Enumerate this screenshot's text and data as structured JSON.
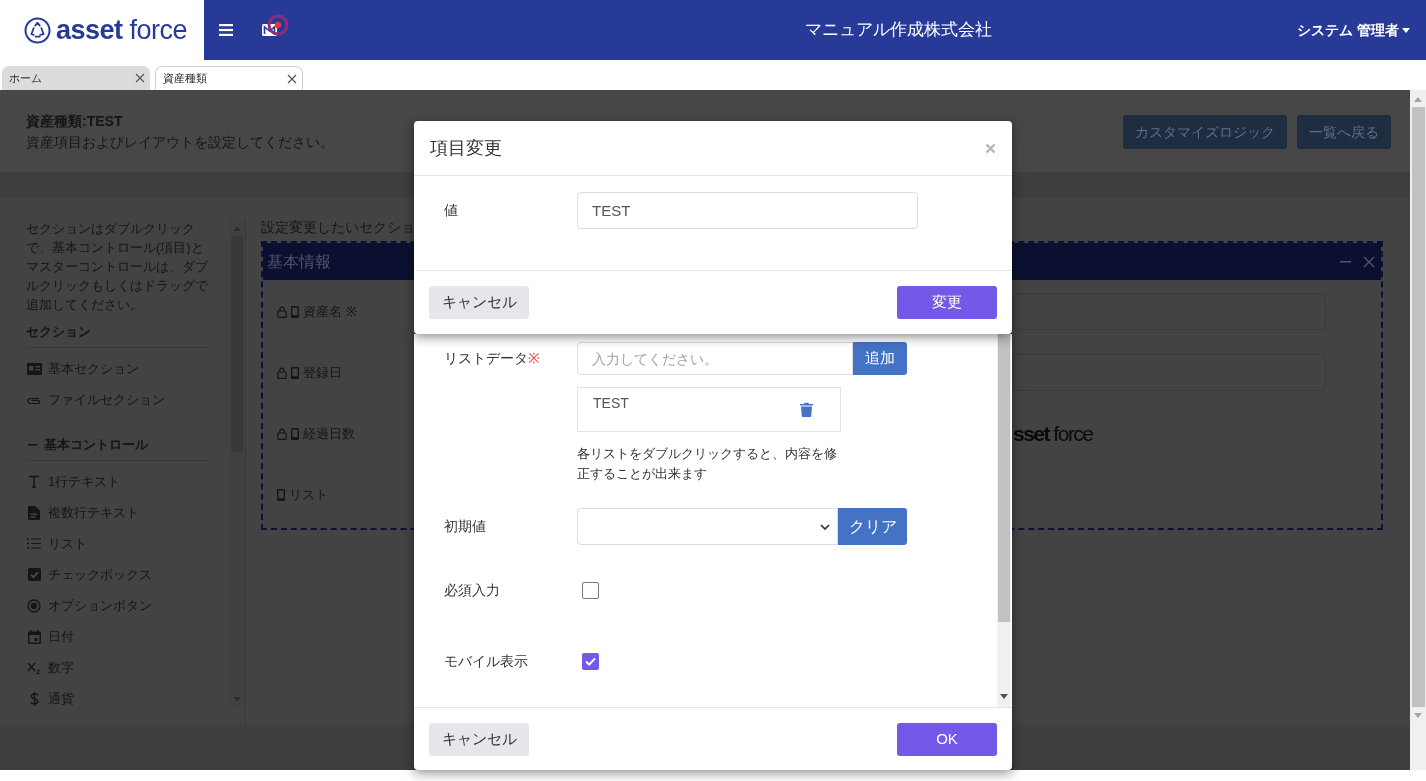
{
  "header": {
    "logo": "**asset** force",
    "mail_unread": true,
    "company": "マニュアル作成株式会社",
    "user": "システム 管理者"
  },
  "tabs": [
    {
      "label": "ホーム",
      "selected": false
    },
    {
      "label": "資産種類",
      "selected": true
    }
  ],
  "page": {
    "title": "資産種類:TEST",
    "subtitle": "資産項目およびレイアウトを設定してください。",
    "buttons": [
      "カスタマイズロジック",
      "一覧へ戻る"
    ]
  },
  "palette": {
    "help": "セクションはダブルクリックで、基本コントロール(項目)とマスターコントロールは、ダブルクリックもしくはドラッグで追加してください。",
    "groups": [
      {
        "title": "セクション",
        "collapsible": false,
        "items": [
          {
            "kind": "section",
            "label": "基本セクション"
          },
          {
            "kind": "file",
            "label": "ファイルセクション"
          }
        ]
      },
      {
        "title": "基本コントロール",
        "collapsible": true,
        "expanded": true,
        "items": [
          {
            "kind": "text",
            "label": "1行テキスト"
          },
          {
            "kind": "multiline",
            "label": "複数行テキスト"
          },
          {
            "kind": "list",
            "label": "リスト"
          },
          {
            "kind": "checkbox",
            "label": "チェックボックス"
          },
          {
            "kind": "radio",
            "label": "オプションボタン"
          },
          {
            "kind": "date",
            "label": "日付"
          },
          {
            "kind": "number",
            "label": "数字"
          },
          {
            "kind": "currency",
            "label": "通貨"
          }
        ]
      }
    ]
  },
  "canvas": {
    "instruction": "設定変更したいセクショ",
    "section": {
      "title": "基本情報",
      "fields": [
        {
          "kind": "input",
          "label": "資産名",
          "mark": "※",
          "locked": true,
          "mobile": true
        },
        {
          "kind": "input",
          "label": "登録日",
          "locked": true,
          "mobile": true
        },
        {
          "kind": "image",
          "label": "経過日数",
          "locked": true,
          "mobile": true,
          "image_text": "**sset** force"
        },
        {
          "kind": "plain",
          "label": "リスト",
          "locked": false,
          "mobile": true
        }
      ]
    }
  },
  "list_modal": {
    "fields": [
      {
        "kind": "list_input",
        "label": "リストデータ",
        "mark": "※",
        "placeholder": "入力してください。",
        "button": "追加",
        "items": [
          {
            "label": "TEST"
          }
        ],
        "help": "各リストをダブルクリックすると、内容を修正することが出来ます"
      },
      {
        "kind": "select",
        "label": "初期値",
        "button": "クリア"
      },
      {
        "kind": "checkbox",
        "label": "必須入力",
        "checked": false
      },
      {
        "kind": "checkbox",
        "label": "モバイル表示",
        "checked": true
      }
    ],
    "buttons": [
      {
        "kind": "secondary",
        "label": "キャンセル"
      },
      {
        "kind": "primary",
        "label": "OK"
      }
    ]
  },
  "edit_modal": {
    "title": "項目変更",
    "fields": [
      {
        "label": "値",
        "value": "TEST"
      }
    ],
    "buttons": [
      {
        "kind": "secondary",
        "label": "キャンセル"
      },
      {
        "kind": "primary",
        "label": "変更"
      }
    ]
  }
}
